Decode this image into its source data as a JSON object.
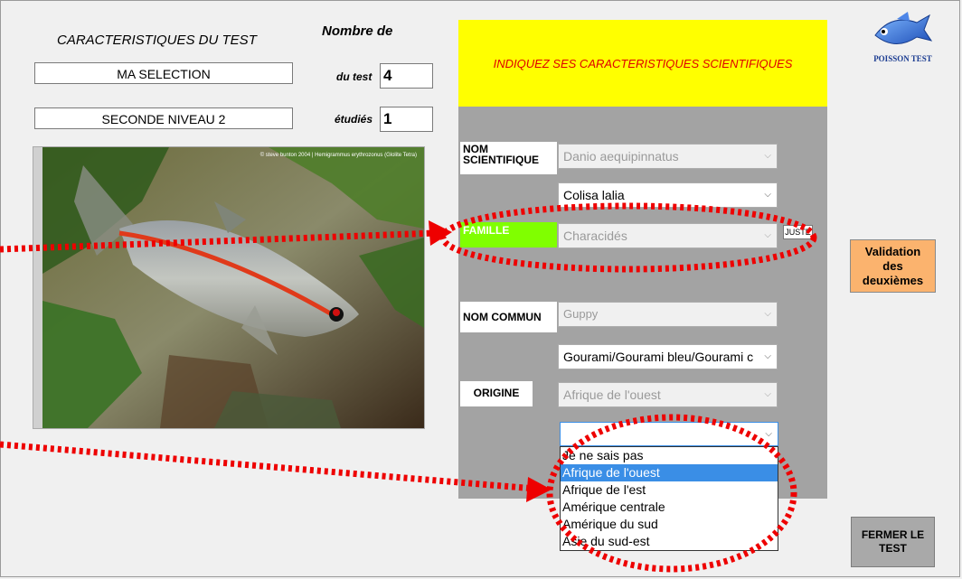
{
  "left": {
    "title": "CARACTERISTIQUES DU TEST",
    "selection_value": "MA SELECTION",
    "niveau_value": "SECONDE NIVEAU 2"
  },
  "counts": {
    "header": "Nombre  de",
    "du_test_label": "du test",
    "du_test_value": "4",
    "etudies_label": "étudiés",
    "etudies_value": "1"
  },
  "photo": {
    "caption": "© steve bunton 2004 | Hemigrammus erythrozonus (Glolite Tetra)"
  },
  "panel": {
    "header": "INDIQUEZ SES CARACTERISTIQUES SCIENTIFIQUES",
    "nom_scientifique_label": "NOM SCIENTIFIQUE",
    "nom_scientifique_value": "Danio aequipinnatus",
    "nom_scientifique_answer": "Colisa lalia",
    "famille_label": "FAMILLE",
    "famille_value": "Characidés",
    "juste_label": "JUSTE",
    "nom_commun_label": "NOM COMMUN",
    "nom_commun_value": "Guppy",
    "nom_commun_answer": "Gourami/Gourami bleu/Gourami c",
    "origine_label": "ORIGINE",
    "origine_value": "Afrique de l'ouest",
    "origine_answer": ""
  },
  "dropdown": {
    "options": [
      "Je ne sais pas",
      "Afrique de l'ouest",
      "Afrique de l'est",
      "Amérique centrale",
      "Amérique du sud",
      "Asie du sud-est"
    ],
    "selected_index": 1
  },
  "buttons": {
    "validation": "Validation des deuxièmes",
    "fermer": "FERMER LE TEST"
  },
  "logo": {
    "text": "POISSON TEST"
  },
  "colors": {
    "yellow": "#ffff00",
    "red_text": "#e00000",
    "famille_green": "#80ff00",
    "validation_orange": "#fbb36e",
    "annotation_red": "#ee0000"
  }
}
